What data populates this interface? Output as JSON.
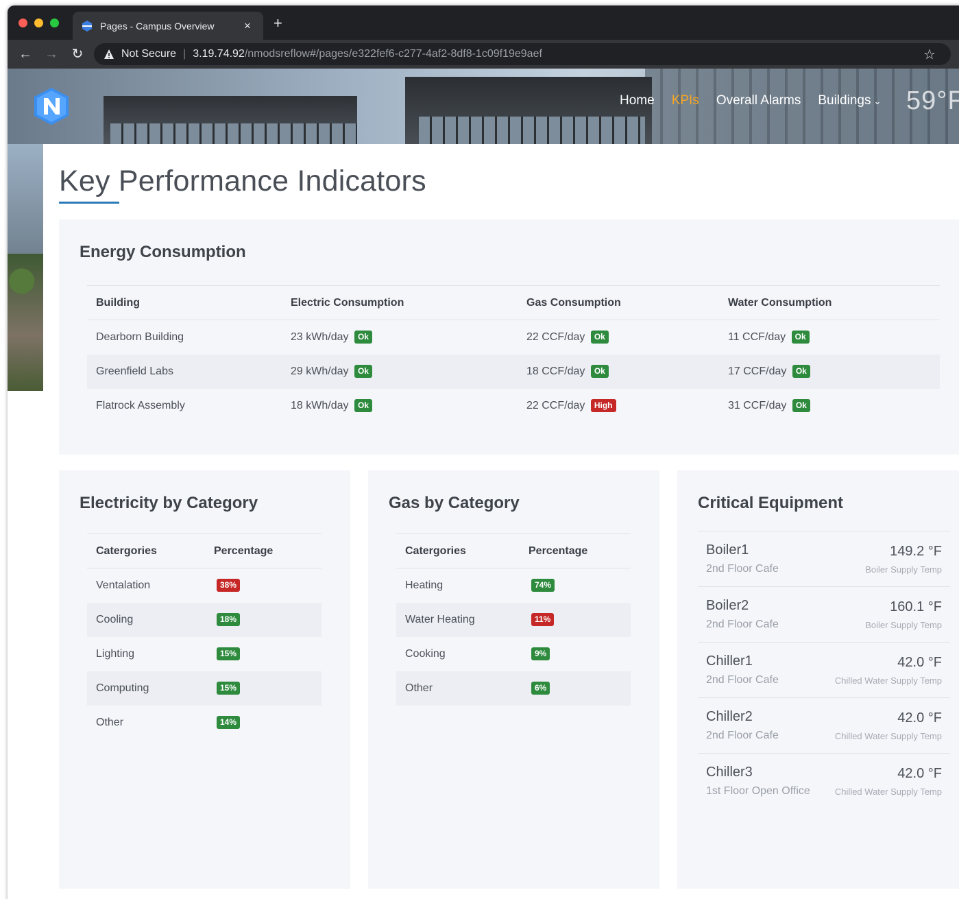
{
  "browser": {
    "tab_title": "Pages - Campus Overview",
    "tab_close": "×",
    "new_tab": "+",
    "security_label": "Not Secure",
    "url_host": "3.19.74.92",
    "url_path": "/nmodsreflow#/pages/e322fef6-c277-4af2-8df8-1c09f19e9aef"
  },
  "nav": {
    "home": "Home",
    "kpis": "KPIs",
    "alarms": "Overall Alarms",
    "buildings": "Buildings",
    "temperature": "59°F",
    "active_color": "#f5a623"
  },
  "page": {
    "title": "Key Performance Indicators"
  },
  "energy": {
    "title": "Energy Consumption",
    "headers": [
      "Building",
      "Electric Consumption",
      "Gas Consumption",
      "Water Consumption"
    ],
    "rows": [
      {
        "building": "Dearborn Building",
        "electric": "23 kWh/day",
        "electric_status": "Ok",
        "gas": "22 CCF/day",
        "gas_status": "Ok",
        "water": "11 CCF/day",
        "water_status": "Ok"
      },
      {
        "building": "Greenfield Labs",
        "electric": "29 kWh/day",
        "electric_status": "Ok",
        "gas": "18 CCF/day",
        "gas_status": "Ok",
        "water": "17 CCF/day",
        "water_status": "Ok"
      },
      {
        "building": "Flatrock Assembly",
        "electric": "18 kWh/day",
        "electric_status": "Ok",
        "gas": "22 CCF/day",
        "gas_status": "High",
        "water": "31 CCF/day",
        "water_status": "Ok"
      }
    ]
  },
  "electricity": {
    "title": "Electricity by Category",
    "headers": [
      "Catergories",
      "Percentage"
    ],
    "rows": [
      {
        "category": "Ventalation",
        "percent": "38%",
        "level": "high"
      },
      {
        "category": "Cooling",
        "percent": "18%",
        "level": "ok"
      },
      {
        "category": "Lighting",
        "percent": "15%",
        "level": "ok"
      },
      {
        "category": "Computing",
        "percent": "15%",
        "level": "ok"
      },
      {
        "category": "Other",
        "percent": "14%",
        "level": "ok"
      }
    ]
  },
  "gas": {
    "title": "Gas by Category",
    "headers": [
      "Catergories",
      "Percentage"
    ],
    "rows": [
      {
        "category": "Heating",
        "percent": "74%",
        "level": "ok"
      },
      {
        "category": "Water Heating",
        "percent": "11%",
        "level": "high"
      },
      {
        "category": "Cooking",
        "percent": "9%",
        "level": "ok"
      },
      {
        "category": "Other",
        "percent": "6%",
        "level": "ok"
      }
    ]
  },
  "equipment": {
    "title": "Critical Equipment",
    "items": [
      {
        "name": "Boiler1",
        "location": "2nd Floor Cafe",
        "value": "149.2 °F",
        "measure": "Boiler Supply Temp"
      },
      {
        "name": "Boiler2",
        "location": "2nd Floor Cafe",
        "value": "160.1 °F",
        "measure": "Boiler Supply Temp"
      },
      {
        "name": "Chiller1",
        "location": "2nd Floor Cafe",
        "value": "42.0 °F",
        "measure": "Chilled Water Supply Temp"
      },
      {
        "name": "Chiller2",
        "location": "2nd Floor Cafe",
        "value": "42.0 °F",
        "measure": "Chilled Water Supply Temp"
      },
      {
        "name": "Chiller3",
        "location": "1st Floor Open Office",
        "value": "42.0 °F",
        "measure": "Chilled Water Supply Temp"
      }
    ]
  },
  "colors": {
    "ok": "#2e8b3e",
    "high": "#c62828",
    "accent": "#2a7ab8"
  }
}
